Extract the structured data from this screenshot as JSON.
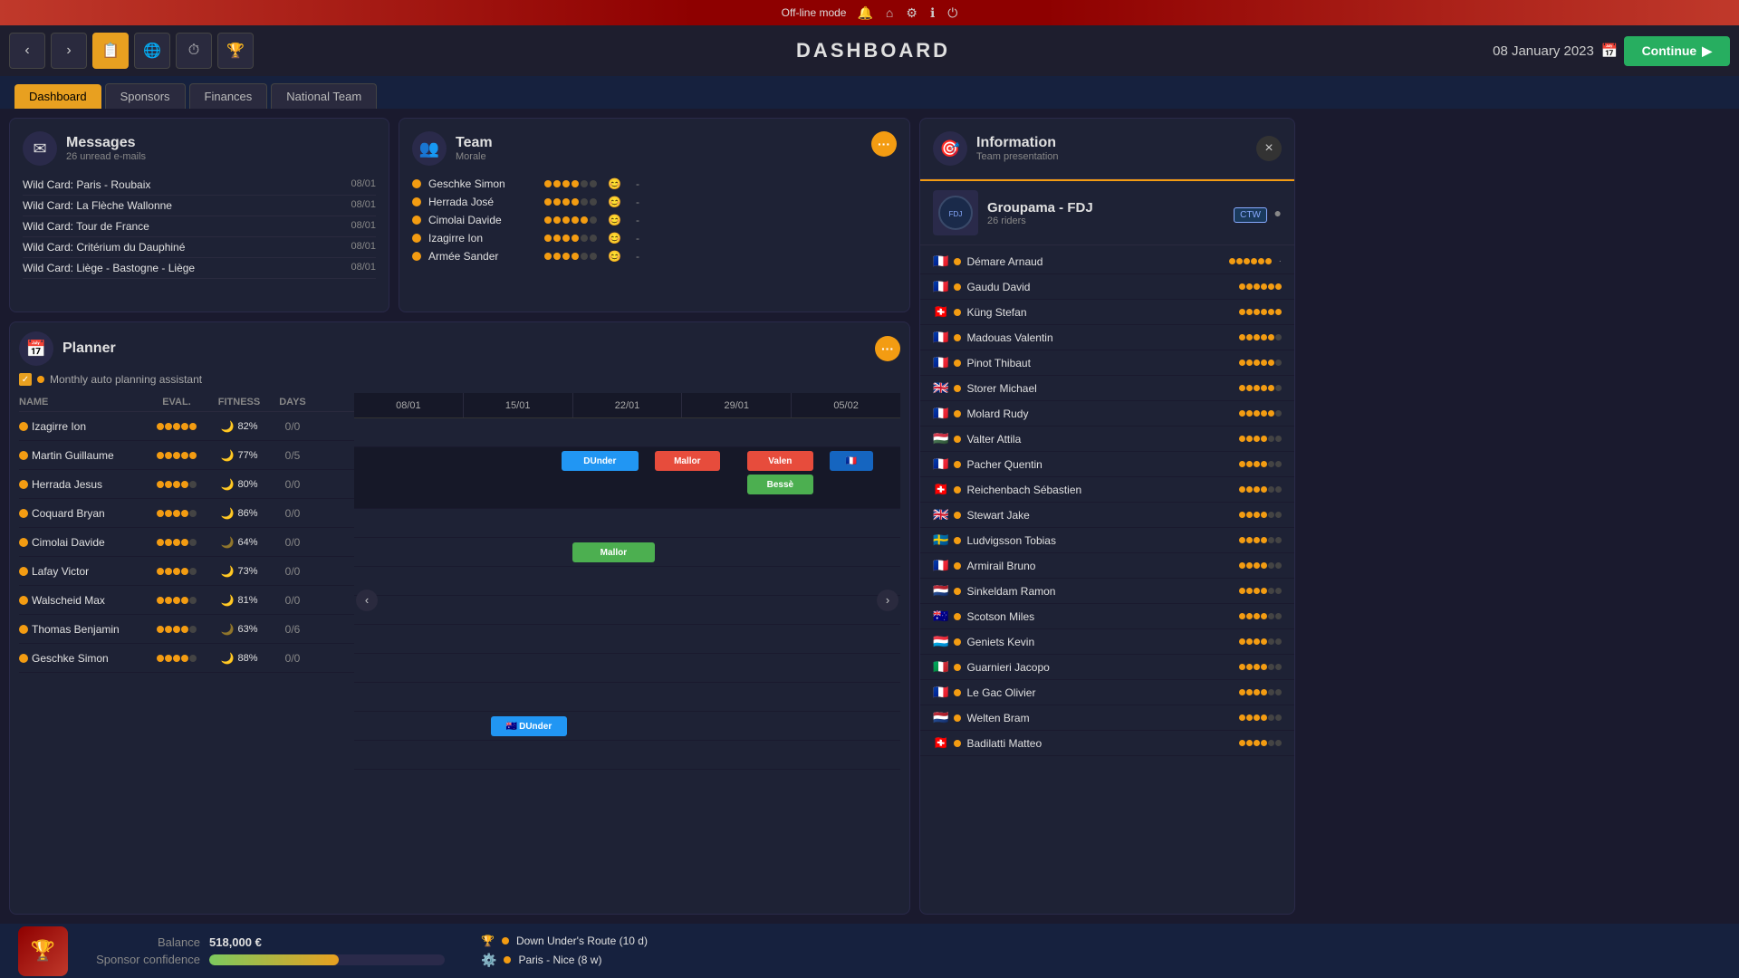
{
  "topbar": {
    "mode": "Off-line mode"
  },
  "navbar": {
    "title": "DASHBOARD",
    "date": "08 January 2023",
    "continue_label": "Continue"
  },
  "tabs": [
    {
      "label": "Dashboard",
      "active": true
    },
    {
      "label": "Sponsors",
      "active": false
    },
    {
      "label": "Finances",
      "active": false
    },
    {
      "label": "National Team",
      "active": false
    }
  ],
  "messages": {
    "title": "Messages",
    "subtitle": "26 unread e-mails",
    "items": [
      {
        "text": "Wild Card: Paris - Roubaix",
        "date": "08/01"
      },
      {
        "text": "Wild Card: La Flèche Wallonne",
        "date": "08/01"
      },
      {
        "text": "Wild Card: Tour de France",
        "date": "08/01"
      },
      {
        "text": "Wild Card: Critérium du Dauphiné",
        "date": "08/01"
      },
      {
        "text": "Wild Card: Liège - Bastogne - Liège",
        "date": "08/01"
      }
    ]
  },
  "team": {
    "title": "Team",
    "subtitle": "Morale",
    "riders": [
      {
        "name": "Geschke Simon",
        "morale": 4,
        "max": 6
      },
      {
        "name": "Herrada José",
        "morale": 4,
        "max": 6
      },
      {
        "name": "Cimolai Davide",
        "morale": 5,
        "max": 6
      },
      {
        "name": "Izagirre Ion",
        "morale": 4,
        "max": 6
      },
      {
        "name": "Armée Sander",
        "morale": 4,
        "max": 6
      }
    ]
  },
  "planner": {
    "title": "Planner",
    "auto_planning": "Monthly auto planning assistant",
    "columns": [
      "NAME",
      "EVAL.",
      "FITNESS",
      "DAYS"
    ],
    "dates": [
      "08/01",
      "15/01",
      "22/01",
      "29/01",
      "05/02"
    ],
    "riders": [
      {
        "name": "Izagirre Ion",
        "eval": 5,
        "fitness": 82,
        "days": "0/0"
      },
      {
        "name": "Martin Guillaume",
        "eval": 5,
        "fitness": 77,
        "days": "0/5"
      },
      {
        "name": "Herrada Jesus",
        "eval": 4,
        "fitness": 80,
        "days": "0/0"
      },
      {
        "name": "Coquard Bryan",
        "eval": 4,
        "fitness": 86,
        "days": "0/0"
      },
      {
        "name": "Cimolai Davide",
        "eval": 4,
        "fitness": 64,
        "days": "0/0"
      },
      {
        "name": "Lafay Victor",
        "eval": 4,
        "fitness": 73,
        "days": "0/0"
      },
      {
        "name": "Walscheid Max",
        "eval": 4,
        "fitness": 81,
        "days": "0/0"
      },
      {
        "name": "Thomas Benjamin",
        "eval": 4,
        "fitness": 63,
        "days": "0/6"
      },
      {
        "name": "Geschke Simon",
        "eval": 4,
        "fitness": 88,
        "days": "0/0"
      }
    ]
  },
  "information": {
    "title": "Information",
    "subtitle": "Team presentation",
    "close": "×",
    "team_name": "Groupama - FDJ",
    "team_riders_count": "26 riders",
    "ctw": "CTW",
    "riders": [
      {
        "name": "Démare Arnaud",
        "flag": "🇫🇷",
        "rating": 6
      },
      {
        "name": "Gaudu David",
        "flag": "🇫🇷",
        "rating": 6
      },
      {
        "name": "Küng Stefan",
        "flag": "🇨🇭",
        "rating": 6
      },
      {
        "name": "Madouas Valentin",
        "flag": "🇫🇷",
        "rating": 5
      },
      {
        "name": "Pinot Thibaut",
        "flag": "🇫🇷",
        "rating": 5
      },
      {
        "name": "Storer Michael",
        "flag": "🇬🇧",
        "rating": 5
      },
      {
        "name": "Molard Rudy",
        "flag": "🇫🇷",
        "rating": 5
      },
      {
        "name": "Valter Attila",
        "flag": "🇭🇺",
        "rating": 4
      },
      {
        "name": "Pacher Quentin",
        "flag": "🇫🇷",
        "rating": 4
      },
      {
        "name": "Reichenbach Sébastien",
        "flag": "🇨🇭",
        "rating": 4
      },
      {
        "name": "Stewart Jake",
        "flag": "🇬🇧",
        "rating": 4
      },
      {
        "name": "Ludvigsson Tobias",
        "flag": "🇸🇪",
        "rating": 4
      },
      {
        "name": "Armirail Bruno",
        "flag": "🇫🇷",
        "rating": 4
      },
      {
        "name": "Sinkeldam Ramon",
        "flag": "🇳🇱",
        "rating": 4
      },
      {
        "name": "Scotson Miles",
        "flag": "🇦🇺",
        "rating": 4
      },
      {
        "name": "Geniets Kevin",
        "flag": "🇱🇺",
        "rating": 4
      },
      {
        "name": "Guarnieri Jacopo",
        "flag": "🇮🇹",
        "rating": 4
      },
      {
        "name": "Le Gac Olivier",
        "flag": "🇫🇷",
        "rating": 4
      },
      {
        "name": "Welten Bram",
        "flag": "🇳🇱",
        "rating": 4
      },
      {
        "name": "Badilatti Matteo",
        "flag": "🇨🇭",
        "rating": 4
      }
    ]
  },
  "bottombar": {
    "balance_label": "Balance",
    "balance_value": "518,000 €",
    "sponsor_label": "Sponsor confidence",
    "sponsor_pct": 55,
    "races": [
      {
        "icon": "🏆",
        "name": "Down Under's Route",
        "detail": "(10 d)"
      },
      {
        "icon": "⚙️",
        "name": "Paris - Nice",
        "detail": "(8 w)"
      }
    ]
  }
}
